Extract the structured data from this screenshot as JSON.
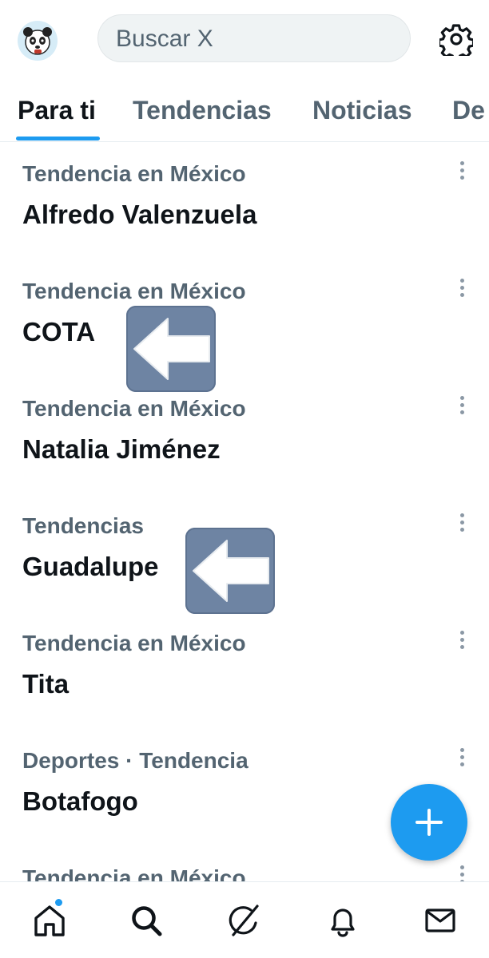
{
  "header": {
    "search_placeholder": "Buscar X",
    "avatar_icon": "panda-avatar-icon",
    "settings_icon": "gear-icon"
  },
  "tabs": [
    {
      "label": "Para ti",
      "active": true
    },
    {
      "label": "Tendencias",
      "active": false
    },
    {
      "label": "Noticias",
      "active": false
    },
    {
      "label": "De",
      "active": false
    }
  ],
  "trends": [
    {
      "context": "Tendencia en México",
      "name": "Alfredo Valenzuela"
    },
    {
      "context": "Tendencia en México",
      "name": "COTA"
    },
    {
      "context": "Tendencia en México",
      "name": "Natalia Jiménez"
    },
    {
      "context": "Tendencias",
      "name": "Guadalupe"
    },
    {
      "context": "Tendencia en México",
      "name": "Tita"
    },
    {
      "context": "Deportes · Tendencia",
      "name": "Botafogo"
    },
    {
      "context": "Tendencia en México",
      "name": ""
    }
  ],
  "overlays": [
    "left-arrow-icon",
    "left-arrow-icon"
  ],
  "fab_icon": "plus-icon",
  "bottom_nav": [
    "home-icon",
    "search-icon",
    "grok-icon",
    "bell-icon",
    "mail-icon"
  ],
  "colors": {
    "accent": "#1d9bf0",
    "text_primary": "#0f1419",
    "text_secondary": "#536471",
    "arrow_badge": "#6e84a3"
  }
}
